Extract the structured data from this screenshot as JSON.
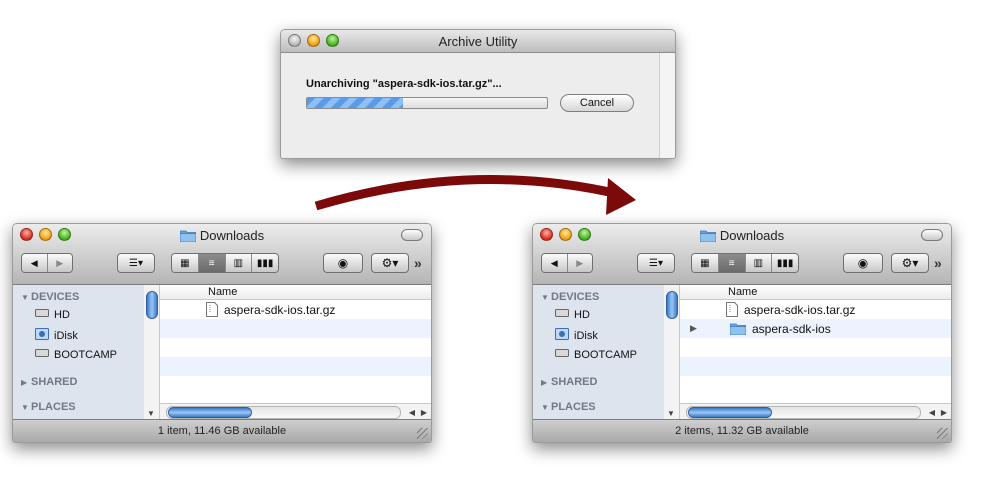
{
  "archive_utility": {
    "title": "Archive Utility",
    "message": "Unarchiving \"aspera-sdk-ios.tar.gz\"...",
    "progress_fraction": 0.4,
    "cancel_label": "Cancel"
  },
  "finder_left": {
    "title": "Downloads",
    "sidebar": {
      "devices_label": "DEVICES",
      "devices": [
        {
          "label": "HD",
          "icon": "hard-drive-icon"
        },
        {
          "label": "iDisk",
          "icon": "idisk-icon"
        },
        {
          "label": "BOOTCAMP",
          "icon": "hard-drive-icon"
        }
      ],
      "shared_label": "SHARED",
      "places_label": "PLACES"
    },
    "column_name": "Name",
    "files": [
      {
        "name": "aspera-sdk-ios.tar.gz",
        "icon": "archive-file-icon"
      }
    ],
    "status": "1 item, 11.46 GB available"
  },
  "finder_right": {
    "title": "Downloads",
    "sidebar": {
      "devices_label": "DEVICES",
      "devices": [
        {
          "label": "HD",
          "icon": "hard-drive-icon"
        },
        {
          "label": "iDisk",
          "icon": "idisk-icon"
        },
        {
          "label": "BOOTCAMP",
          "icon": "hard-drive-icon"
        }
      ],
      "shared_label": "SHARED",
      "places_label": "PLACES"
    },
    "column_name": "Name",
    "files": [
      {
        "name": "aspera-sdk-ios.tar.gz",
        "icon": "archive-file-icon"
      },
      {
        "name": "aspera-sdk-ios",
        "icon": "folder-icon"
      }
    ],
    "status": "2 items, 11.32 GB available"
  },
  "colors": {
    "arrow": "#7d0a0a",
    "progress": "#5b9ae8",
    "sidebar_bg": "#dde4ed"
  }
}
